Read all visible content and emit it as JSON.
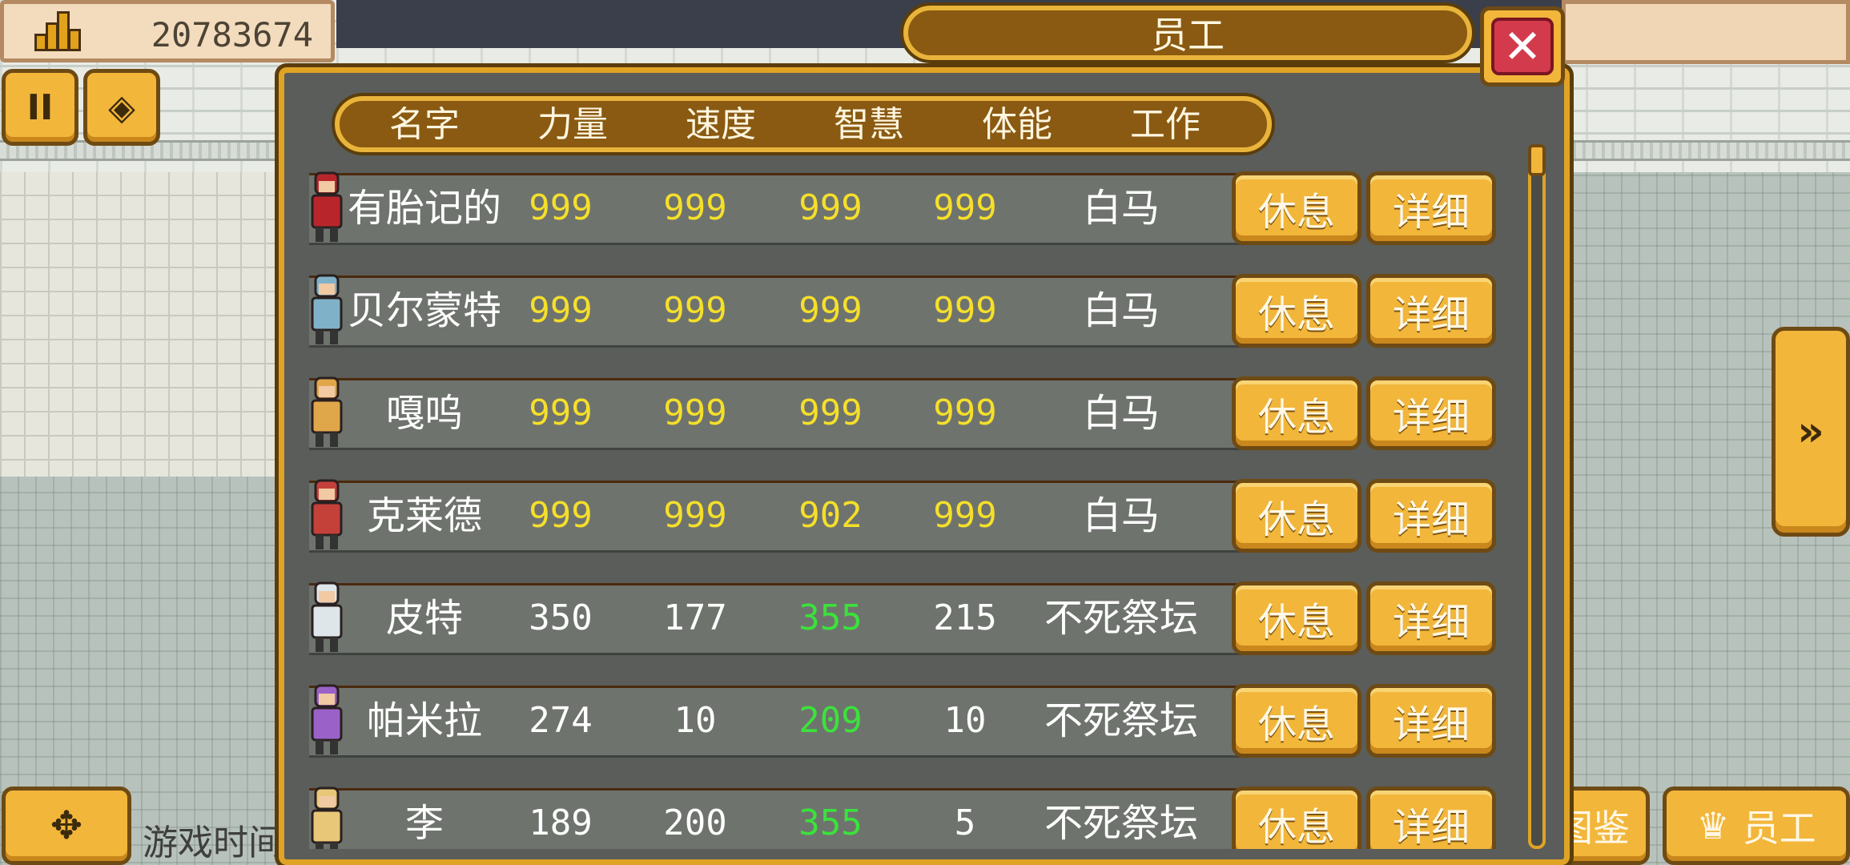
{
  "hud": {
    "money": "20783674",
    "pause_label": "II",
    "game_time_label": "游戏时间"
  },
  "bottom_buttons": {
    "encyclopedia_label": "图鉴",
    "staff_label": "员工"
  },
  "panel": {
    "title": "员工",
    "close_label": "✕",
    "columns": [
      "名字",
      "力量",
      "速度",
      "智慧",
      "体能",
      "工作"
    ]
  },
  "employees": [
    {
      "name": "有胎记的",
      "strength": "999",
      "speed": "999",
      "wisdom": "999",
      "stamina": "999",
      "job": "白马",
      "rest_label": "休息",
      "detail_label": "详细",
      "strength_color": "yellow",
      "speed_color": "yellow",
      "wisdom_color": "yellow",
      "stamina_color": "yellow",
      "avatar_color": "#b8262c"
    },
    {
      "name": "贝尔蒙特",
      "strength": "999",
      "speed": "999",
      "wisdom": "999",
      "stamina": "999",
      "job": "白马",
      "rest_label": "休息",
      "detail_label": "详细",
      "strength_color": "yellow",
      "speed_color": "yellow",
      "wisdom_color": "yellow",
      "stamina_color": "yellow",
      "avatar_color": "#7fb2c8"
    },
    {
      "name": "嘎呜",
      "strength": "999",
      "speed": "999",
      "wisdom": "999",
      "stamina": "999",
      "job": "白马",
      "rest_label": "休息",
      "detail_label": "详细",
      "strength_color": "yellow",
      "speed_color": "yellow",
      "wisdom_color": "yellow",
      "stamina_color": "yellow",
      "avatar_color": "#e0a64a"
    },
    {
      "name": "克莱德",
      "strength": "999",
      "speed": "999",
      "wisdom": "902",
      "stamina": "999",
      "job": "白马",
      "rest_label": "休息",
      "detail_label": "详细",
      "strength_color": "yellow",
      "speed_color": "yellow",
      "wisdom_color": "yellow",
      "stamina_color": "yellow",
      "avatar_color": "#c4413a"
    },
    {
      "name": "皮特",
      "strength": "350",
      "speed": "177",
      "wisdom": "355",
      "stamina": "215",
      "job": "不死祭坛",
      "rest_label": "休息",
      "detail_label": "详细",
      "strength_color": "white",
      "speed_color": "white",
      "wisdom_color": "green",
      "stamina_color": "white",
      "avatar_color": "#dfe6ea"
    },
    {
      "name": "帕米拉",
      "strength": "274",
      "speed": "10",
      "wisdom": "209",
      "stamina": "10",
      "job": "不死祭坛",
      "rest_label": "休息",
      "detail_label": "详细",
      "strength_color": "white",
      "speed_color": "white",
      "wisdom_color": "green",
      "stamina_color": "white",
      "avatar_color": "#9a62c8"
    },
    {
      "name": "李",
      "strength": "189",
      "speed": "200",
      "wisdom": "355",
      "stamina": "5",
      "job": "不死祭坛",
      "rest_label": "休息",
      "detail_label": "详细",
      "strength_color": "white",
      "speed_color": "white",
      "wisdom_color": "green",
      "stamina_color": "white",
      "avatar_color": "#e8c878"
    }
  ]
}
